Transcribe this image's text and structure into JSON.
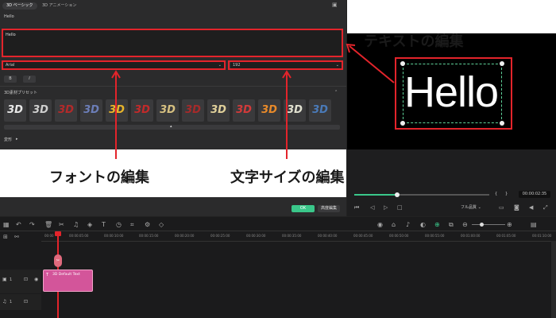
{
  "tabs": {
    "basic": "3D ベーシック",
    "animation": "3D アニメーション"
  },
  "text_label": "Hello",
  "text_value": "Hello",
  "font": {
    "name": "Arial",
    "size": "192"
  },
  "style_buttons": {
    "bold": "B",
    "italic": "I"
  },
  "preset_section": "3D素材プリセット",
  "presets": [
    "3D",
    "3D",
    "3D",
    "3D",
    "3D",
    "3D",
    "3D",
    "3D",
    "3D",
    "3D",
    "3D",
    "3D",
    "3D"
  ],
  "transform_label": "変形",
  "buttons": {
    "ok": "OK",
    "advanced": "高度編集"
  },
  "preview": {
    "text": "Hello",
    "timecode": "00:00:02:35",
    "quality": "フル品質",
    "brace_open": "{",
    "brace_close": "}"
  },
  "annotations": {
    "text_edit": "テキストの編集",
    "font_edit": "フォントの編集",
    "size_edit": "文字サイズの編集"
  },
  "ruler": [
    "00:00",
    "00:00:05:00",
    "00:00:10:00",
    "00:00:15:00",
    "00:00:20:00",
    "00:00:25:00",
    "00:00:30:00",
    "00:00:35:00",
    "00:00:40:00",
    "00:00:45:00",
    "00:00:50:00",
    "00:00:55:00",
    "00:01:00:00",
    "00:01:05:00",
    "00:01:10:00"
  ],
  "clip": {
    "label": "3D Default Text"
  },
  "tracks": {
    "video": "1",
    "audio": "1"
  },
  "colors": {
    "accent": "#3ac78a",
    "red": "#e3242b",
    "clip": "#d3559a"
  }
}
